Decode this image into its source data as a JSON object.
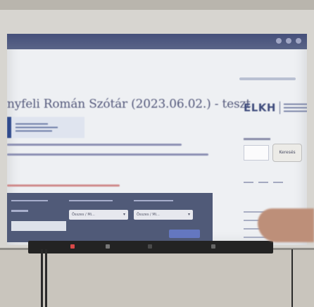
{
  "browser": {
    "icons": [
      "bell-icon",
      "user-icon",
      "menu-icon"
    ]
  },
  "page": {
    "title": "nyfeli Román Szótár (2023.06.02.) - teszt",
    "logo_text": "ELKH"
  },
  "sidebar": {
    "search_button": "Keresés"
  },
  "filters": {
    "select_1": "Összes / Mi...",
    "select_2": "Összes / Mi..."
  },
  "colors": {
    "accent": "#505a78",
    "link": "#cf8a8a",
    "taskbar": "#2d3246"
  }
}
